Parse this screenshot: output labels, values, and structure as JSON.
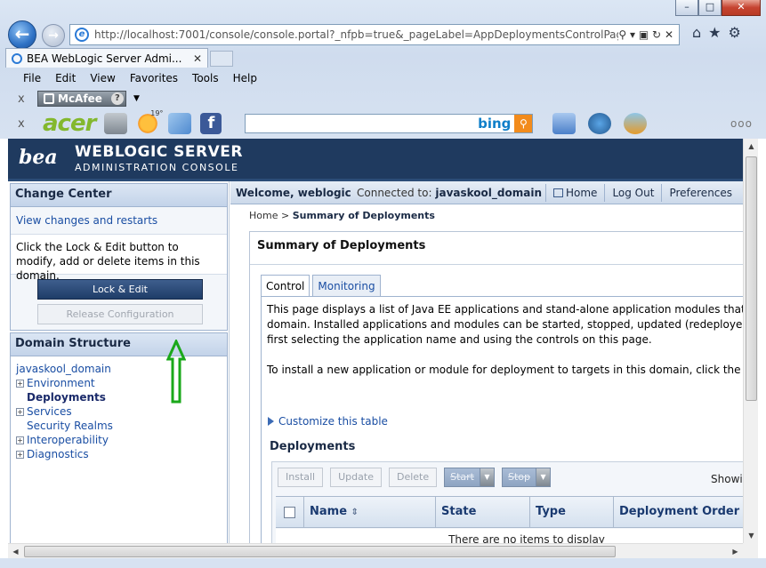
{
  "browser": {
    "url": "http://localhost:7001/console/console.portal?_nfpb=true&_pageLabel=AppDeploymentsControlPage",
    "tab_title": "BEA WebLogic Server Admi...",
    "menu": [
      "File",
      "Edit",
      "View",
      "Favorites",
      "Tools",
      "Help"
    ],
    "mcafee_label": "McAfee",
    "acer_label": "acer",
    "bing_label": "bing",
    "weather_temp": "19°"
  },
  "banner": {
    "logo": "bea",
    "product": "WEBLOGIC SERVER",
    "subtitle": "ADMINISTRATION CONSOLE"
  },
  "change_center": {
    "title": "Change Center",
    "link": "View changes and restarts",
    "info": "Click the Lock & Edit button to modify, add or delete items in this domain.",
    "lock_button": "Lock & Edit",
    "release_button": "Release Configuration"
  },
  "domain_structure": {
    "title": "Domain Structure",
    "root": "javaskool_domain",
    "items": [
      {
        "label": "Environment",
        "expandable": true
      },
      {
        "label": "Deployments",
        "expandable": false,
        "selected": true
      },
      {
        "label": "Services",
        "expandable": true
      },
      {
        "label": "Security Realms",
        "expandable": false
      },
      {
        "label": "Interoperability",
        "expandable": true
      },
      {
        "label": "Diagnostics",
        "expandable": true
      }
    ]
  },
  "topbar": {
    "welcome": "Welcome, weblogic",
    "connected_label": "Connected to:",
    "domain": "javaskool_domain",
    "home": "Home",
    "logout": "Log Out",
    "preferences": "Preferences"
  },
  "breadcrumb": {
    "home": "Home",
    "sep": ">",
    "current": "Summary of Deployments"
  },
  "main": {
    "title": "Summary of Deployments",
    "tabs": [
      "Control",
      "Monitoring"
    ],
    "para1_line1": "This page displays a list of Java EE applications and stand-alone application modules that have",
    "para1_line2": "domain. Installed applications and modules can be started, stopped, updated (redeployed), or",
    "para1_line3": "first selecting the application name and using the controls on this page.",
    "para2": "To install a new application or module for deployment to targets in this domain, click the Insta",
    "customize": "Customize this table",
    "deployments_title": "Deployments",
    "buttons": [
      "Install",
      "Update",
      "Delete"
    ],
    "start": "Start",
    "stop": "Stop",
    "showing": "Showin",
    "columns": [
      "Name",
      "State",
      "Type",
      "Deployment Order"
    ],
    "empty": "There are no items to display"
  }
}
